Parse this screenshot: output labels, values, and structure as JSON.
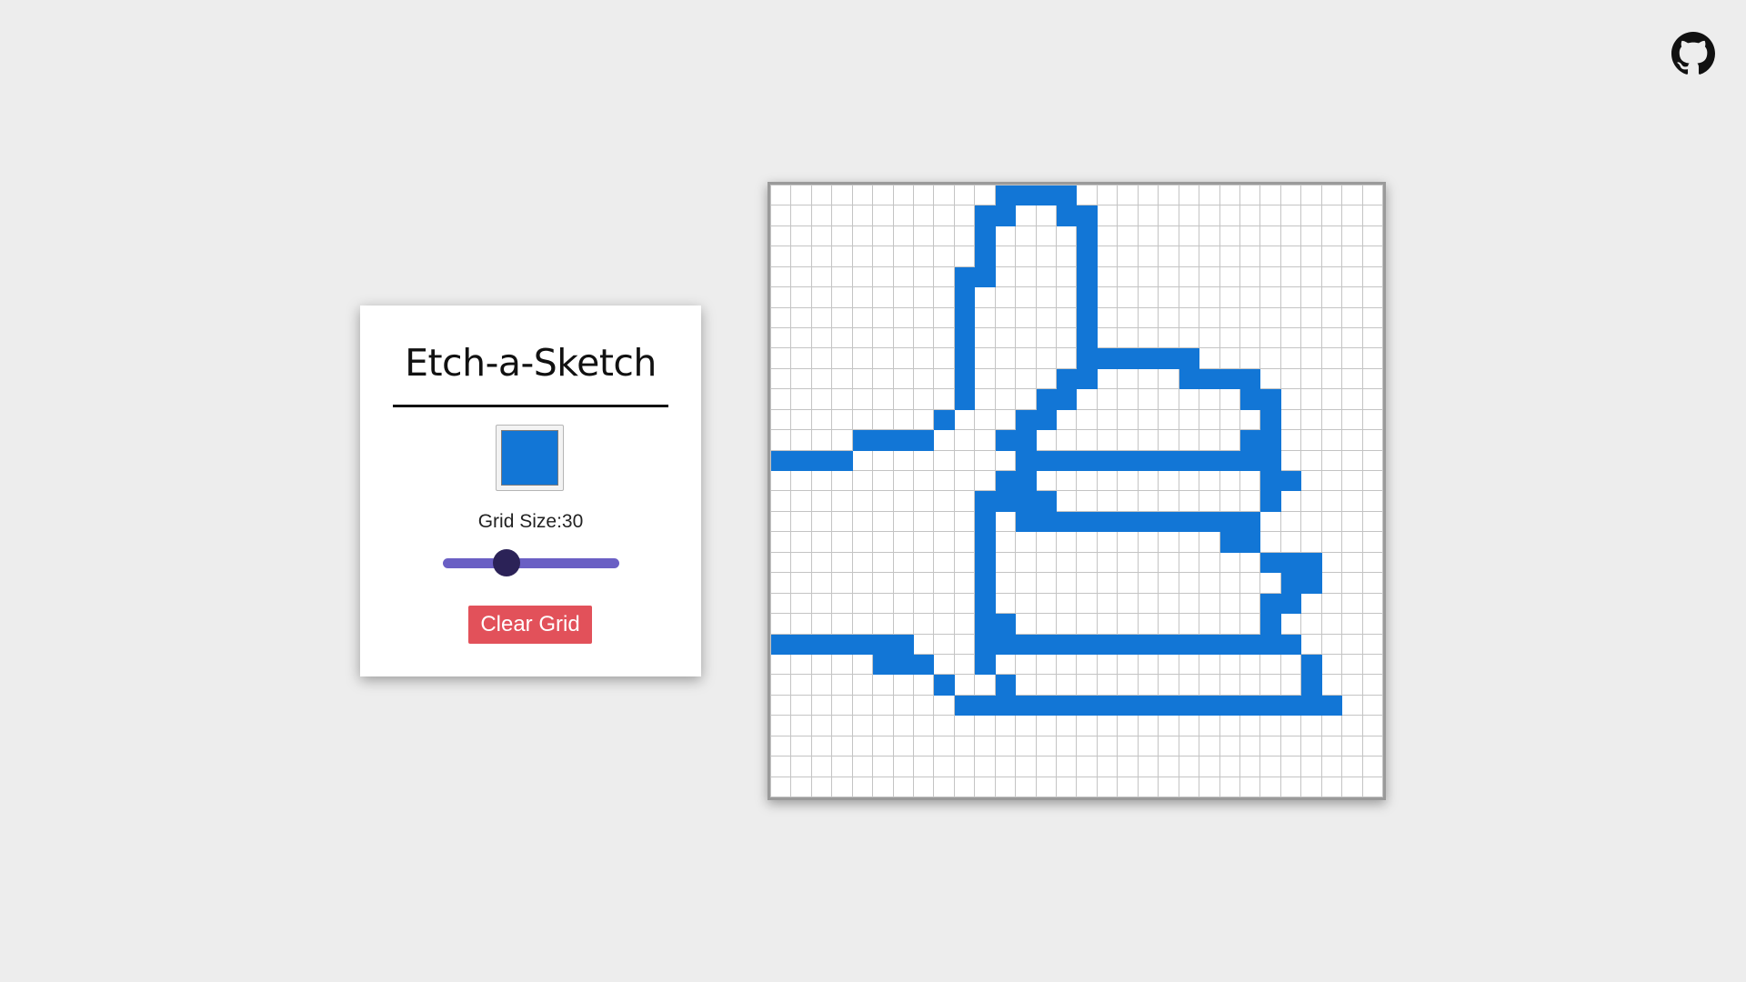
{
  "app": {
    "title": "Etch-a-Sketch"
  },
  "controls": {
    "selected_color": "#1276d6",
    "grid_size_label": "Grid Size:",
    "grid_size_value": "30",
    "slider_min": 2,
    "slider_max": 100,
    "slider_value": 30,
    "clear_label": "Clear Grid"
  },
  "colors": {
    "background": "#ededed",
    "accent": "#1276d6",
    "slider": "#6a5fc4",
    "slider_thumb": "#2b2257",
    "clear_button": "#e2515a"
  },
  "icons": {
    "corner_link": "github-icon"
  },
  "drawing": {
    "grid_size": 30,
    "fill_color": "#1276d6",
    "rows": [
      "...........9999...............",
      "..........99..99..............",
      "..........9....9..............",
      "..........9....9..............",
      ".........99....9..............",
      ".........9.....9..............",
      ".........9.....9..............",
      ".........9.....9..............",
      ".........9.....999999.........",
      ".........9....99....9999......",
      ".........9...99........99.....",
      "........9...99..........9.....",
      "....5555...99..........99.....",
      "5555........9999999999999.....",
      "...........99...........99....",
      "..........9999..........9.....",
      "..........9.999999999999......",
      "..........9...........99......",
      "..........9.............999...",
      "..........9..............99...",
      "..........9.............99....",
      "..........99............9.....",
      "9999999...9999999999999999....",
      ".....999..9...............9...",
      "........9..9..............9...",
      ".........9999999999999999999..",
      "..............................",
      "..............................",
      "..............................",
      ".............................."
    ]
  }
}
